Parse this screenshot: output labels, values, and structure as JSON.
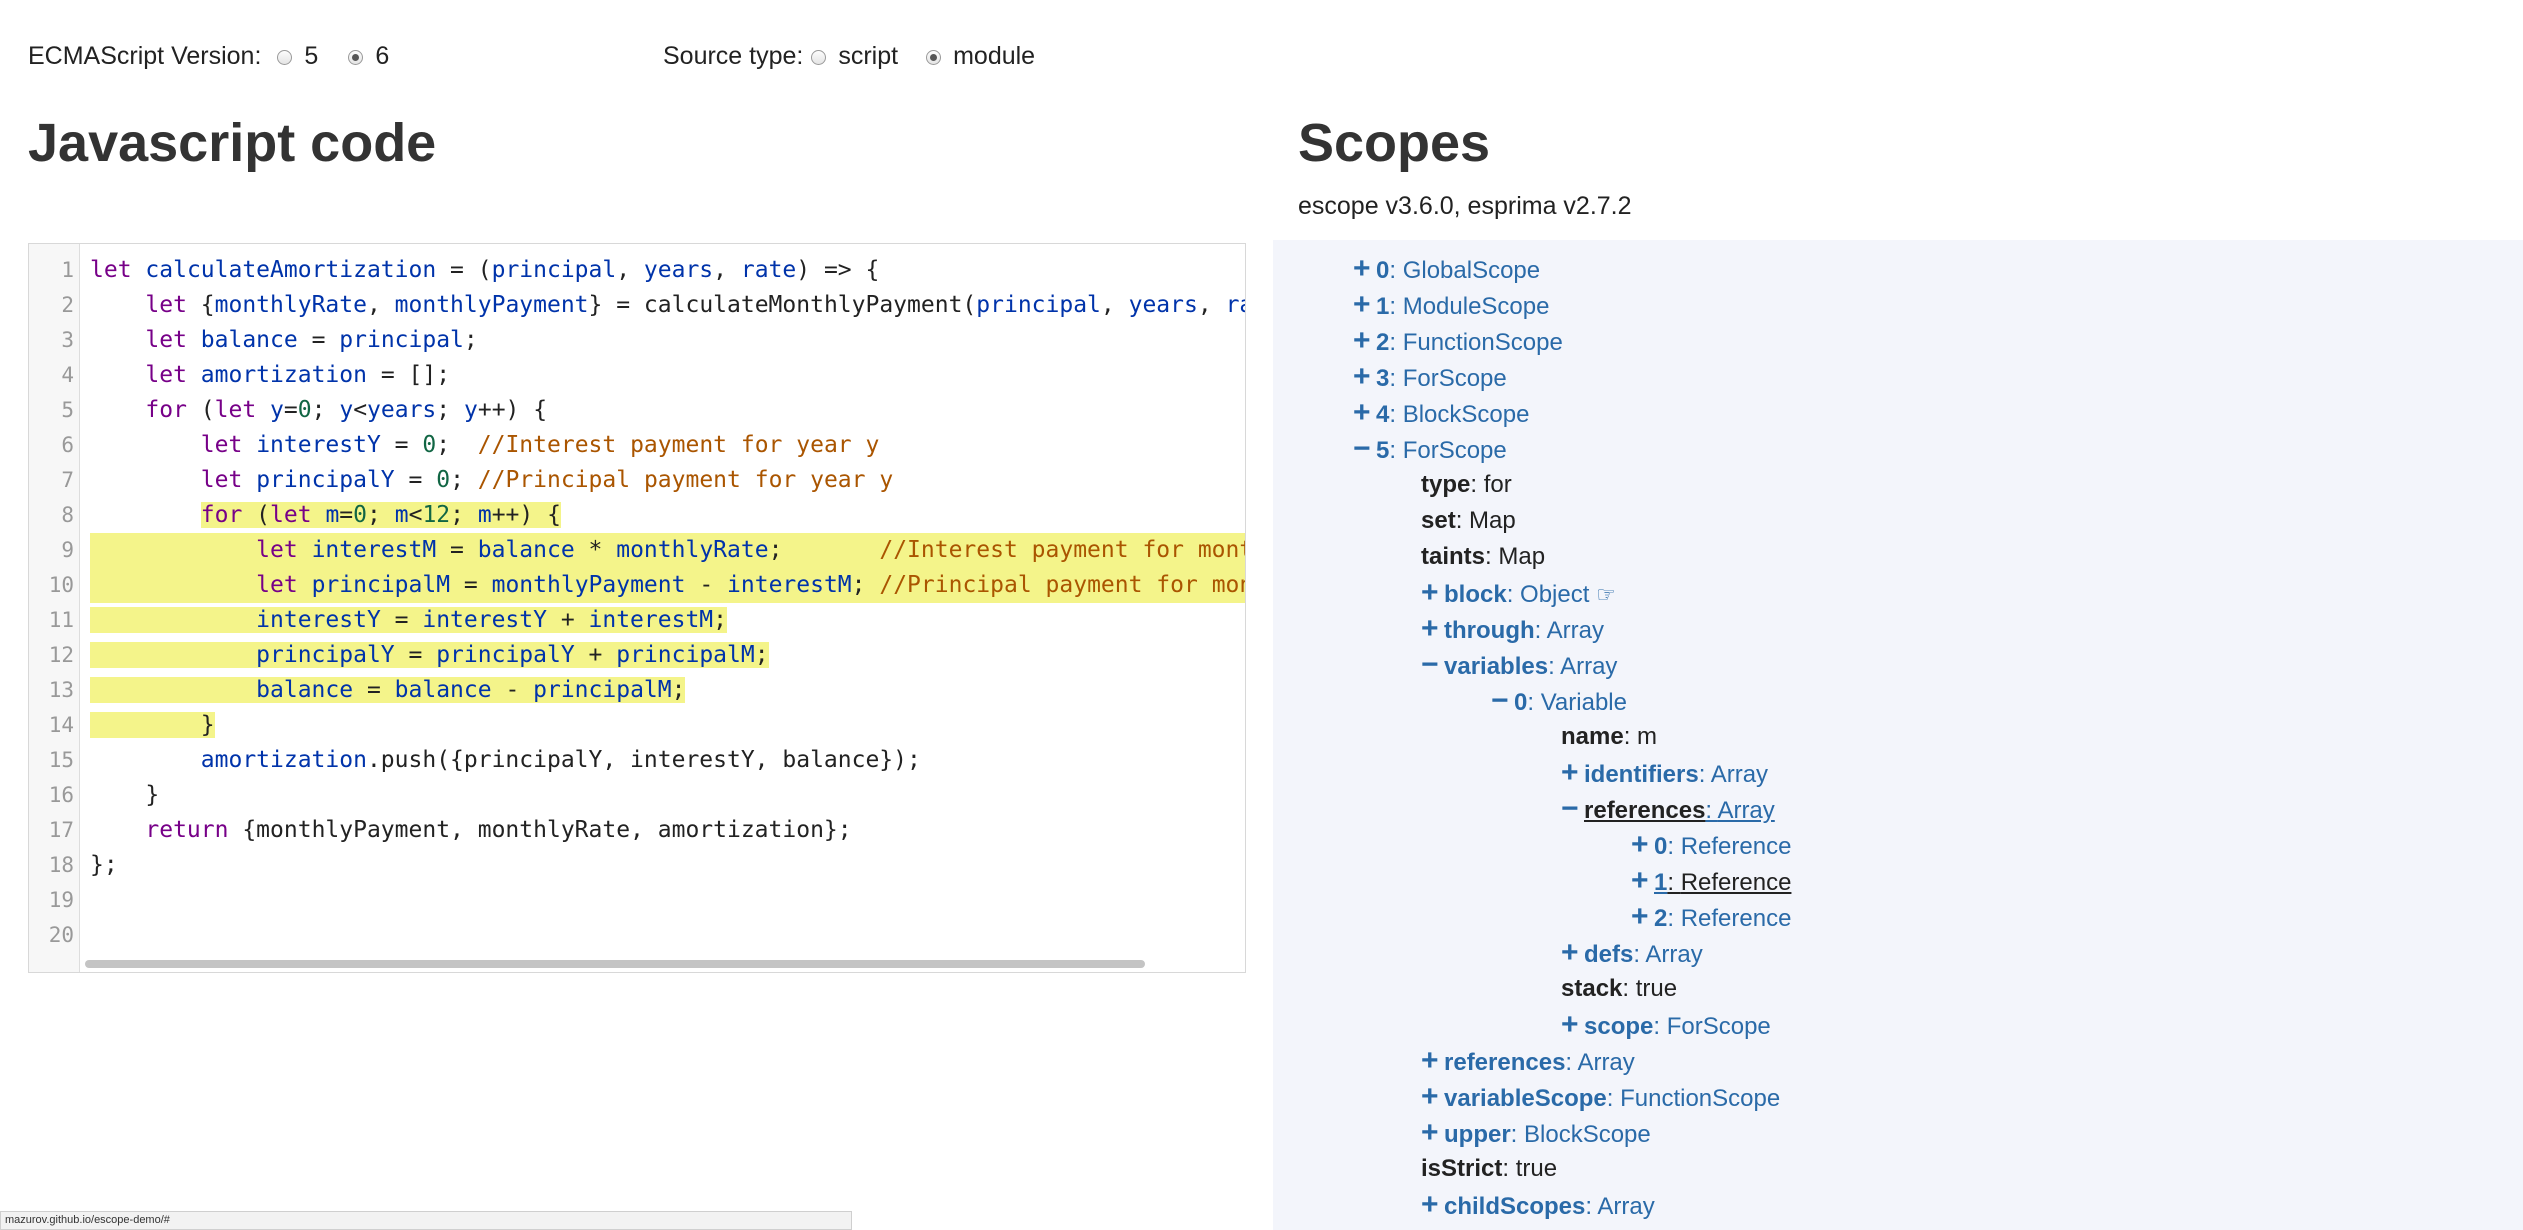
{
  "options": {
    "ecma_label": "ECMAScript Version:",
    "ecma_options": [
      "5",
      "6"
    ],
    "ecma_selected": "6",
    "source_label": "Source type:",
    "source_options": [
      "script",
      "module"
    ],
    "source_selected": "module"
  },
  "code_panel": {
    "title": "Javascript code",
    "line_numbers": [
      "1",
      "2",
      "3",
      "4",
      "5",
      "6",
      "7",
      "8",
      "9",
      "10",
      "11",
      "12",
      "13",
      "14",
      "15",
      "16",
      "17",
      "18",
      "19",
      "20"
    ]
  },
  "scopes_panel": {
    "title": "Scopes",
    "subtitle": "escope v3.6.0, esprima v2.7.2",
    "tree": [
      {
        "toggle": "+",
        "key": "0",
        "sep": ": ",
        "value": "GlobalScope"
      },
      {
        "toggle": "+",
        "key": "1",
        "sep": ": ",
        "value": "ModuleScope"
      },
      {
        "toggle": "+",
        "key": "2",
        "sep": ": ",
        "value": "FunctionScope"
      },
      {
        "toggle": "+",
        "key": "3",
        "sep": ": ",
        "value": "ForScope"
      },
      {
        "toggle": "+",
        "key": "4",
        "sep": ": ",
        "value": "BlockScope"
      },
      {
        "toggle": "−",
        "key": "5",
        "sep": ": ",
        "value": "ForScope"
      },
      {
        "toggle": "",
        "key": "type",
        "sep": ": ",
        "value": "for"
      },
      {
        "toggle": "",
        "key": "set",
        "sep": ": ",
        "value": "Map"
      },
      {
        "toggle": "",
        "key": "taints",
        "sep": ": ",
        "value": "Map"
      },
      {
        "toggle": "+",
        "key": "block",
        "sep": ": ",
        "value": "Object"
      },
      {
        "toggle": "+",
        "key": "through",
        "sep": ": ",
        "value": "Array"
      },
      {
        "toggle": "−",
        "key": "variables",
        "sep": ": ",
        "value": "Array"
      },
      {
        "toggle": "−",
        "key": "0",
        "sep": ": ",
        "value": "Variable"
      },
      {
        "toggle": "",
        "key": "name",
        "sep": ": ",
        "value": "m"
      },
      {
        "toggle": "+",
        "key": "identifiers",
        "sep": ": ",
        "value": "Array"
      },
      {
        "toggle": "−",
        "key": "references",
        "sep": ": ",
        "value": "Array"
      },
      {
        "toggle": "+",
        "key": "0",
        "sep": ": ",
        "value": "Reference"
      },
      {
        "toggle": "+",
        "key": "1",
        "sep": ": ",
        "value": "Reference"
      },
      {
        "toggle": "+",
        "key": "2",
        "sep": ": ",
        "value": "Reference"
      },
      {
        "toggle": "+",
        "key": "defs",
        "sep": ": ",
        "value": "Array"
      },
      {
        "toggle": "",
        "key": "stack",
        "sep": ": ",
        "value": "true"
      },
      {
        "toggle": "+",
        "key": "scope",
        "sep": ": ",
        "value": "ForScope"
      },
      {
        "toggle": "+",
        "key": "references",
        "sep": ": ",
        "value": "Array"
      },
      {
        "toggle": "+",
        "key": "variableScope",
        "sep": ": ",
        "value": "FunctionScope"
      },
      {
        "toggle": "+",
        "key": "upper",
        "sep": ": ",
        "value": "BlockScope"
      },
      {
        "toggle": "",
        "key": "isStrict",
        "sep": ": ",
        "value": "true"
      },
      {
        "toggle": "+",
        "key": "childScopes",
        "sep": ": ",
        "value": "Array"
      }
    ]
  },
  "status_bar": {
    "url": "mazurov.github.io/escope-demo/#"
  }
}
